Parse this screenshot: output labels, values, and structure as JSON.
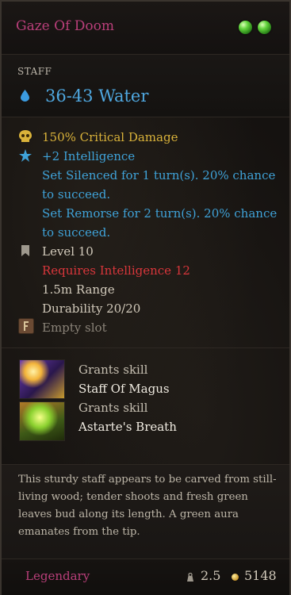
{
  "item": {
    "name": "Gaze Of Doom",
    "type": "STAFF",
    "damage": "36-43 Water"
  },
  "properties": {
    "crit": "150% Critical Damage",
    "intelligence": "+2 Intelligence",
    "silenced_line1": "Set Silenced for 1 turn(s). 20% chance",
    "silenced_line2": "to succeed.",
    "remorse_line1": "Set Remorse for 2 turn(s). 20% chance",
    "remorse_line2": "to succeed.",
    "level": "Level 10",
    "requirement": "Requires Intelligence 12",
    "range": "1.5m Range",
    "durability": "Durability 20/20",
    "rune_slot": "Empty slot"
  },
  "skills": [
    {
      "grant_label": "Grants skill",
      "name": "Staff Of Magus"
    },
    {
      "grant_label": "Grants skill",
      "name": "Astarte's Breath"
    }
  ],
  "description": "This sturdy staff appears to be carved from still-living wood; tender shoots and fresh green leaves bud along its length. A green aura emanates from the tip.",
  "footer": {
    "rarity": "Legendary",
    "weight": "2.5",
    "value": "5148"
  },
  "colors": {
    "legendary": "#b93f7a",
    "water": "#4fa8e0",
    "bonus": "#3fa2d8",
    "critical": "#d9b23a",
    "requirement": "#d8363b"
  }
}
